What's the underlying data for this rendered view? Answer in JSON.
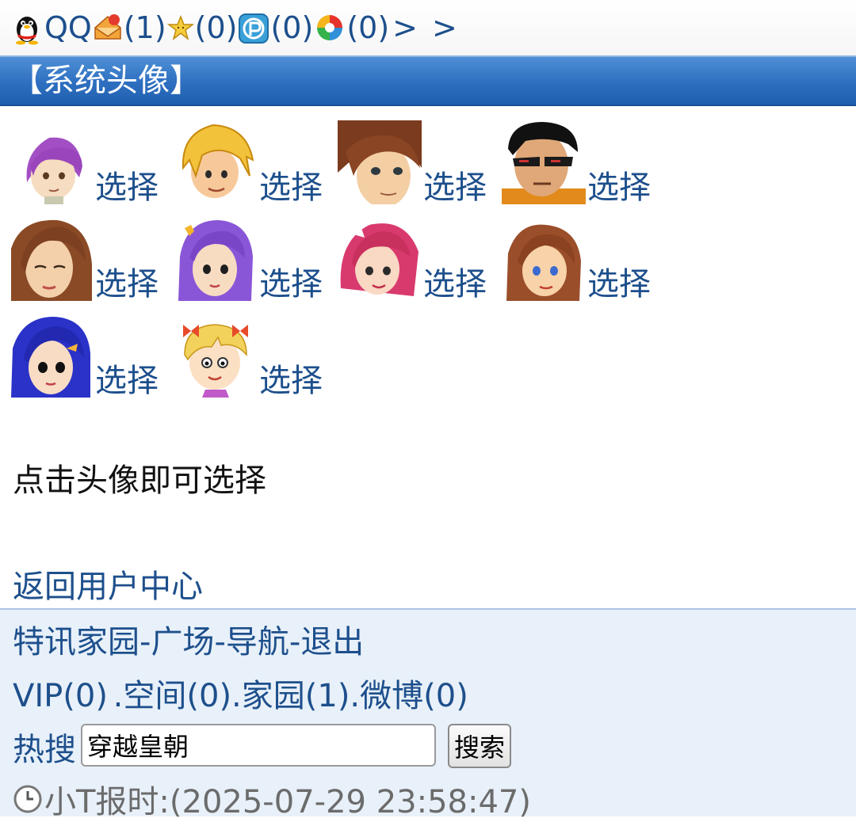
{
  "topbar": {
    "brand": "QQ",
    "mail_count": "(1)",
    "favorites_count": "(0)",
    "space_count": "(0)",
    "app_count": "(0)",
    "more_1": ">",
    "more_2": ">"
  },
  "section": {
    "title": "【系统头像】"
  },
  "avatars": {
    "select_label": "选择",
    "items": [
      {
        "icon": "boy-purple-hair-avatar"
      },
      {
        "icon": "boy-blond-hair-avatar"
      },
      {
        "icon": "boy-brown-hair-avatar"
      },
      {
        "icon": "boy-sunglasses-avatar"
      },
      {
        "icon": "girl-brown-hair-avatar"
      },
      {
        "icon": "girl-purple-hair-avatar"
      },
      {
        "icon": "girl-pink-hair-avatar"
      },
      {
        "icon": "girl-auburn-hair-avatar"
      },
      {
        "icon": "girl-blue-hair-avatar"
      },
      {
        "icon": "kid-blond-bows-avatar"
      }
    ]
  },
  "hint": "点击头像即可选择",
  "back_link": "返回用户中心",
  "footer": {
    "nav": [
      "特讯家园",
      "广场",
      "导航",
      "退出"
    ],
    "nav_separator": "-",
    "counts": {
      "vip": "VIP(0)",
      "space": ".空间(0)",
      "home": ".家园(1)",
      "weibo": ".微博(0)"
    },
    "search": {
      "label": "热搜",
      "value": "穿越皇朝",
      "button": "搜索"
    },
    "clock": "小T报时:(2025-07-29 23:58:47)"
  },
  "colors": {
    "link": "#1d4f8c",
    "title_bar": "#2e6fc0",
    "footer_bg": "#e8f0f9"
  }
}
